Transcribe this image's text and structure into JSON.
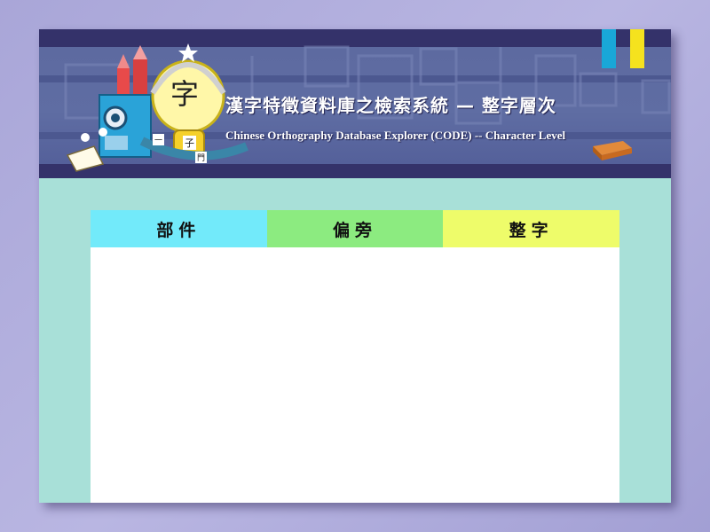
{
  "header": {
    "title_cn": "漢字特徵資料庫之檢索系統 — 整字層次",
    "title_en": "Chinese Orthography Database Explorer (CODE) -- Character Level",
    "mascot_character": "字",
    "mascot_labels": [
      "子",
      "門",
      "一"
    ]
  },
  "tabs": [
    {
      "label": "部件",
      "color": "#72eafa"
    },
    {
      "label": "偏旁",
      "color": "#8ceb80"
    },
    {
      "label": "整字",
      "color": "#eefc6a"
    }
  ],
  "colors": {
    "background": "#aaa7da",
    "banner": "#3c3a6e",
    "content_area": "#a8e0d8",
    "accent_cyan": "#19a7d8",
    "accent_yellow": "#f5e21e"
  }
}
